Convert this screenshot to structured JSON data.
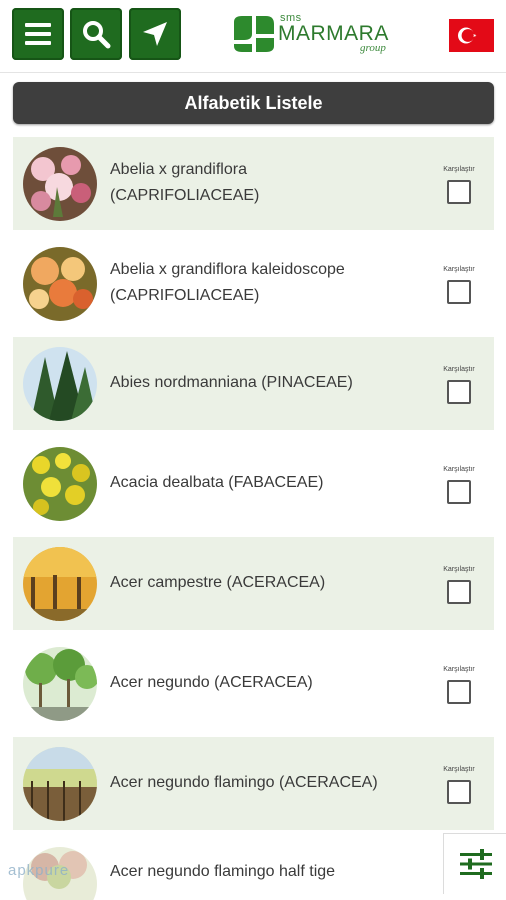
{
  "header": {
    "menu_icon": "hamburger-menu-icon",
    "search_icon": "search-icon",
    "location_icon": "navigation-arrow-icon",
    "logo": {
      "small": "sms",
      "name": "MARMARA",
      "tagline": "group"
    },
    "language_flag": "turkey-flag-icon",
    "accent_color": "#1f6b1f"
  },
  "sort_bar": {
    "label": "Alfabetik Listele"
  },
  "compare_label": "Karşılaştır",
  "plants": [
    {
      "name_line1": "Abelia x grandiflora",
      "name_line2": "(CAPRIFOLIACEAE)"
    },
    {
      "name_line1": "Abelia x grandiflora kaleidoscope",
      "name_line2": "(CAPRIFOLIACEAE)"
    },
    {
      "name_line1": "Abies nordmanniana (PINACEAE)",
      "name_line2": ""
    },
    {
      "name_line1": "Acacia dealbata (FABACEAE)",
      "name_line2": ""
    },
    {
      "name_line1": "Acer campestre (ACERACEA)",
      "name_line2": ""
    },
    {
      "name_line1": "Acer negundo (ACERACEA)",
      "name_line2": ""
    },
    {
      "name_line1": "Acer negundo flamingo (ACERACEA)",
      "name_line2": ""
    },
    {
      "name_line1": "Acer negundo flamingo half tige",
      "name_line2": ""
    }
  ],
  "filter_button_icon": "filter-sliders-icon",
  "watermark": "apkpure"
}
